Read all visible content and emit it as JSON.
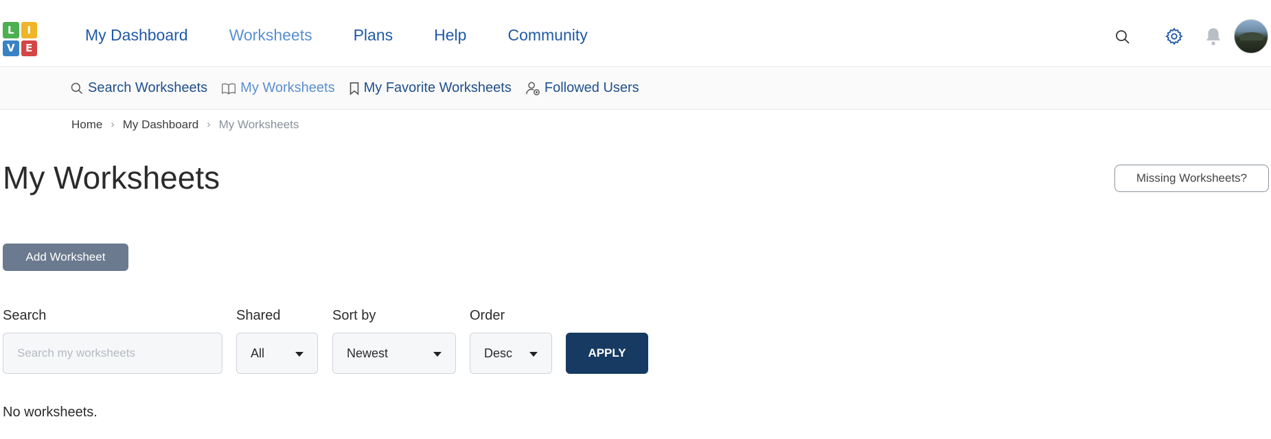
{
  "logo": {
    "letters": [
      "L",
      "I",
      "V",
      "E"
    ]
  },
  "mainnav": {
    "items": [
      {
        "label": "My Dashboard"
      },
      {
        "label": "Worksheets"
      },
      {
        "label": "Plans"
      },
      {
        "label": "Help"
      },
      {
        "label": "Community"
      }
    ],
    "active": "Worksheets"
  },
  "subnav": {
    "items": [
      {
        "label": "Search Worksheets",
        "icon": "search-icon"
      },
      {
        "label": "My Worksheets",
        "icon": "book-icon"
      },
      {
        "label": "My Favorite Worksheets",
        "icon": "bookmark-icon"
      },
      {
        "label": "Followed Users",
        "icon": "user-follow-icon"
      }
    ],
    "active": "My Worksheets"
  },
  "breadcrumb": {
    "home": "Home",
    "dashboard": "My Dashboard",
    "current": "My Worksheets"
  },
  "page": {
    "title": "My Worksheets",
    "missing_label": "Missing Worksheets?",
    "add_label": "Add Worksheet",
    "empty_message": "No worksheets."
  },
  "filters": {
    "search_label": "Search",
    "search_placeholder": "Search my worksheets",
    "search_value": "",
    "shared_label": "Shared",
    "shared_value": "All",
    "sort_label": "Sort by",
    "sort_value": "Newest",
    "order_label": "Order",
    "order_value": "Desc",
    "apply_label": "APPLY"
  },
  "colors": {
    "nav_link": "#1f5aa6",
    "nav_active": "#5b8fd1",
    "apply_bg": "#163a62",
    "add_bg": "#6b7a8f"
  }
}
